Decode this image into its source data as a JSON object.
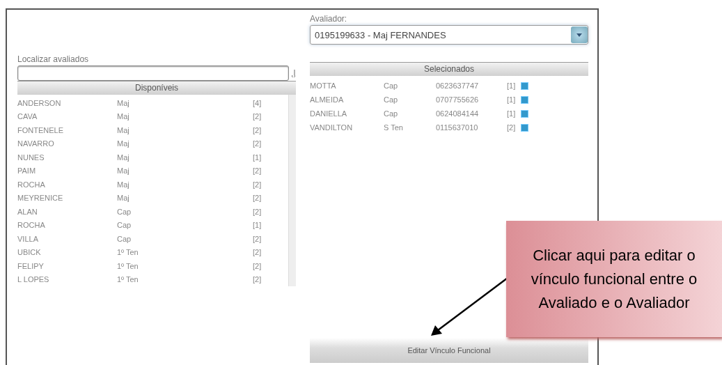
{
  "search": {
    "label": "Localizar avaliados"
  },
  "available": {
    "header": "Disponíveis",
    "rows": [
      {
        "name": "ANDERSON",
        "rank": "Maj",
        "count": "[4]"
      },
      {
        "name": "CAVA",
        "rank": "Maj",
        "count": "[2]"
      },
      {
        "name": "FONTENELE",
        "rank": "Maj",
        "count": "[2]"
      },
      {
        "name": "NAVARRO",
        "rank": "Maj",
        "count": "[2]"
      },
      {
        "name": "NUNES",
        "rank": "Maj",
        "count": "[1]"
      },
      {
        "name": "PAIM",
        "rank": "Maj",
        "count": "[2]"
      },
      {
        "name": "ROCHA",
        "rank": "Maj",
        "count": "[2]"
      },
      {
        "name": "MEYRENICE",
        "rank": "Maj",
        "count": "[2]"
      },
      {
        "name": "ALAN",
        "rank": "Cap",
        "count": "[2]"
      },
      {
        "name": "ROCHA",
        "rank": "Cap",
        "count": "[1]"
      },
      {
        "name": "VILLA",
        "rank": "Cap",
        "count": "[2]"
      },
      {
        "name": "UBICK",
        "rank": "1º Ten",
        "count": "[2]"
      },
      {
        "name": "FELIPY",
        "rank": "1º Ten",
        "count": "[2]"
      },
      {
        "name": "L LOPES",
        "rank": "1º Ten",
        "count": "[2]"
      }
    ]
  },
  "evaluator": {
    "label": "Avaliador:",
    "value": "0195199633 - Maj FERNANDES"
  },
  "selected": {
    "header": "Selecionados",
    "rows": [
      {
        "name": "MOTTA",
        "rank": "Cap",
        "id": "0623637747",
        "count": "[1]"
      },
      {
        "name": "ALMEIDA",
        "rank": "Cap",
        "id": "0707755626",
        "count": "[1]"
      },
      {
        "name": "DANIELLA",
        "rank": "Cap",
        "id": "0624084144",
        "count": "[1]"
      },
      {
        "name": "VANDILTON",
        "rank": "S Ten",
        "id": "0115637010",
        "count": "[2]"
      }
    ]
  },
  "edit_button": "Editar Vínculo Funcional",
  "callout": "Clicar aqui para editar o vínculo funcional entre o Avaliado e o Avaliador"
}
